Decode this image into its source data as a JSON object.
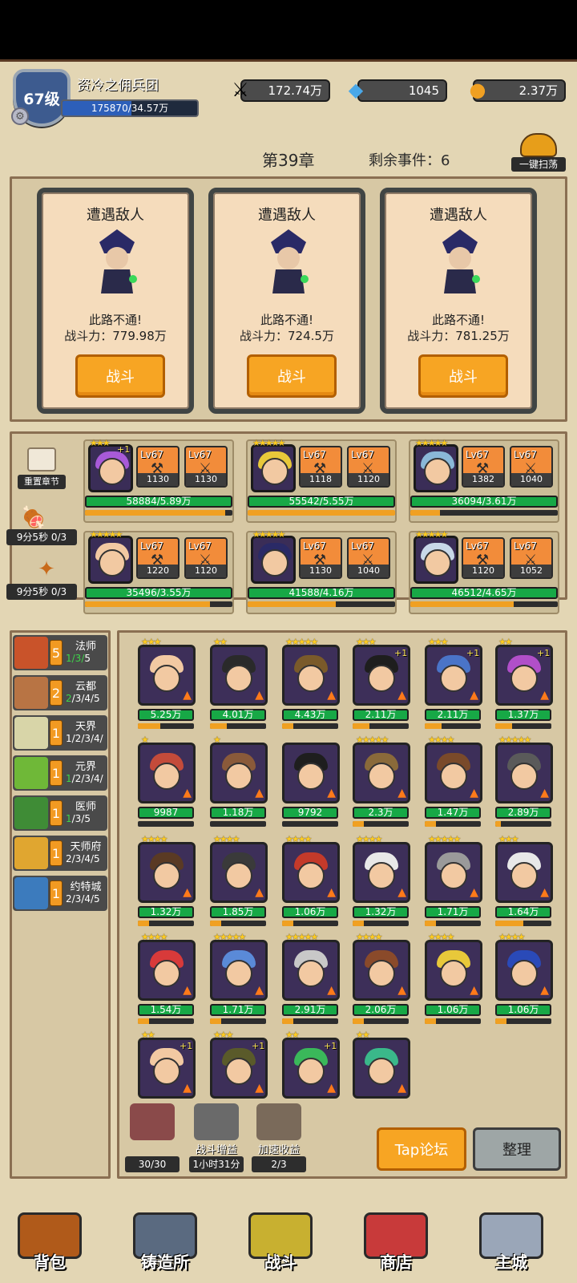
{
  "header": {
    "level": "67级",
    "guild_name": "资冷之佣兵团",
    "exp_text": "175870/34.57万",
    "exp_ratio": 0.51,
    "power": "172.74万",
    "gems": "1045",
    "gold": "2.37万"
  },
  "chapter": {
    "title": "第39章",
    "remaining": "剩余事件：6",
    "sweep_label": "一键扫荡"
  },
  "events": [
    {
      "title": "遭遇敌人",
      "msg": "此路不通!",
      "power": "战斗力：779.98万",
      "button": "战斗"
    },
    {
      "title": "遭遇敌人",
      "msg": "此路不通!",
      "power": "战斗力：724.5万",
      "button": "战斗"
    },
    {
      "title": "遭遇敌人",
      "msg": "此路不通!",
      "power": "战斗力：781.25万",
      "button": "战斗"
    }
  ],
  "side_actions": {
    "reset": "重置章节",
    "timer1": "9分5秒 0/3",
    "timer2": "9分5秒 0/3"
  },
  "team": [
    {
      "stars": "★★★",
      "plus": "+1",
      "eq1_lv": "Lv67",
      "eq1": "1130",
      "eq2_lv": "Lv67",
      "eq2": "1130",
      "hp": "58884/5.89万",
      "fill": 0.95
    },
    {
      "stars": "★★★★★",
      "plus": "",
      "eq1_lv": "Lv67",
      "eq1": "1118",
      "eq2_lv": "Lv67",
      "eq2": "1120",
      "hp": "55542/5.55万",
      "fill": 1.0
    },
    {
      "stars": "★★★★★",
      "plus": "",
      "eq1_lv": "Lv67",
      "eq1": "1382",
      "eq2_lv": "Lv67",
      "eq2": "1040",
      "hp": "36094/3.61万",
      "fill": 0.2
    },
    {
      "stars": "★★★★★",
      "plus": "",
      "eq1_lv": "Lv67",
      "eq1": "1220",
      "eq2_lv": "Lv67",
      "eq2": "1120",
      "hp": "35496/3.55万",
      "fill": 0.85
    },
    {
      "stars": "★★★★★",
      "plus": "",
      "eq1_lv": "Lv67",
      "eq1": "1130",
      "eq2_lv": "Lv67",
      "eq2": "1040",
      "hp": "41588/4.16万",
      "fill": 0.6
    },
    {
      "stars": "★★★★★",
      "plus": "",
      "eq1_lv": "Lv67",
      "eq1": "1120",
      "eq2_lv": "Lv67",
      "eq2": "1052",
      "hp": "46512/4.65万",
      "fill": 0.7
    }
  ],
  "factions": [
    {
      "name": "法师",
      "count": "5",
      "prog_green": "1/3/",
      "prog_rest": "5",
      "color": "#c9532a"
    },
    {
      "name": "云都",
      "count": "2",
      "prog_green": "2",
      "prog_rest": "/3/4/5",
      "color": "#b87444"
    },
    {
      "name": "天界",
      "count": "1",
      "prog_green": "",
      "prog_rest": "1/2/3/4/",
      "color": "#d8d5a8"
    },
    {
      "name": "元界",
      "count": "1",
      "prog_green": "1",
      "prog_rest": "/2/3/4/",
      "color": "#6fb838"
    },
    {
      "name": "医师",
      "count": "1",
      "prog_green": "1",
      "prog_rest": "/3/5",
      "color": "#3f8c36"
    },
    {
      "name": "天师府",
      "count": "1",
      "prog_green": "",
      "prog_rest": "2/3/4/5",
      "color": "#e0a630"
    },
    {
      "name": "约特城",
      "count": "1",
      "prog_green": "",
      "prog_rest": "2/3/4/5",
      "color": "#3c7bbd"
    }
  ],
  "roster": [
    {
      "stars": "★★★",
      "plus": "",
      "power": "5.25万",
      "hair": "#f2c9a2",
      "fill": 0.4
    },
    {
      "stars": "★★",
      "plus": "",
      "power": "4.01万",
      "hair": "#2a2a2a",
      "fill": 0.3
    },
    {
      "stars": "★★★★★",
      "plus": "",
      "power": "4.43万",
      "hair": "#7a5a2a",
      "fill": 0.2
    },
    {
      "stars": "★★★",
      "plus": "+1",
      "power": "2.11万",
      "hair": "#1e1e1e",
      "fill": 0.3
    },
    {
      "stars": "★★★",
      "plus": "+1",
      "power": "2.11万",
      "hair": "#4a74c8",
      "fill": 0.3
    },
    {
      "stars": "★★",
      "plus": "+1",
      "power": "1.37万",
      "hair": "#b14fc9",
      "fill": 0.3
    },
    {
      "stars": "★",
      "plus": "",
      "power": "9987",
      "hair": "#c44b3a",
      "fill": 0.0
    },
    {
      "stars": "★",
      "plus": "",
      "power": "1.18万",
      "hair": "#8a5a3a",
      "fill": 0.0
    },
    {
      "stars": "",
      "plus": "",
      "power": "9792",
      "hair": "#1e1e1e",
      "fill": 0.0
    },
    {
      "stars": "★★★★★",
      "plus": "",
      "power": "2.3万",
      "hair": "#8a6a3a",
      "fill": 0.2
    },
    {
      "stars": "★★★★",
      "plus": "",
      "power": "1.47万",
      "hair": "#7a4a2a",
      "fill": 0.2
    },
    {
      "stars": "★★★★★",
      "plus": "",
      "power": "2.89万",
      "hair": "#5a5a5a",
      "fill": 0.1
    },
    {
      "stars": "★★★★",
      "plus": "",
      "power": "1.32万",
      "hair": "#5a3a24",
      "fill": 0.2
    },
    {
      "stars": "★★★★",
      "plus": "",
      "power": "1.85万",
      "hair": "#3a3a3a",
      "fill": 0.2
    },
    {
      "stars": "★★★★",
      "plus": "",
      "power": "1.06万",
      "hair": "#c43a2a",
      "fill": 0.2
    },
    {
      "stars": "★★★★",
      "plus": "",
      "power": "1.32万",
      "hair": "#e8e8e8",
      "fill": 0.2
    },
    {
      "stars": "★★★★★",
      "plus": "",
      "power": "1.71万",
      "hair": "#9a9a9a",
      "fill": 0.2
    },
    {
      "stars": "★★★",
      "plus": "",
      "power": "1.64万",
      "hair": "#e8e8e8",
      "fill": 0.5
    },
    {
      "stars": "★★★★",
      "plus": "",
      "power": "1.54万",
      "hair": "#d83a3a",
      "fill": 0.2
    },
    {
      "stars": "★★★★★",
      "plus": "",
      "power": "1.71万",
      "hair": "#5a8ad8",
      "fill": 0.2
    },
    {
      "stars": "★★★★★",
      "plus": "",
      "power": "2.91万",
      "hair": "#c8c8c8",
      "fill": 0.2
    },
    {
      "stars": "★★★★",
      "plus": "",
      "power": "2.06万",
      "hair": "#8a4a2a",
      "fill": 0.2
    },
    {
      "stars": "★★★★",
      "plus": "",
      "power": "1.06万",
      "hair": "#e8c83a",
      "fill": 0.2
    },
    {
      "stars": "★★★★",
      "plus": "",
      "power": "1.06万",
      "hair": "#2a4ab8",
      "fill": 0.2
    },
    {
      "stars": "★★",
      "plus": "+1",
      "power": "",
      "hair": "#f2c9a2",
      "fill": 0.0
    },
    {
      "stars": "★★★",
      "plus": "+1",
      "power": "",
      "hair": "#5a5a2a",
      "fill": 0.0
    },
    {
      "stars": "★★",
      "plus": "+1",
      "power": "",
      "hair": "#3ab85a",
      "fill": 0.0
    },
    {
      "stars": "★★",
      "plus": "",
      "power": "",
      "hair": "#3ab88a",
      "fill": 0.0
    }
  ],
  "tools": [
    {
      "label": "",
      "sub": "30/30"
    },
    {
      "label": "战斗增益",
      "sub": "1小时31分"
    },
    {
      "label": "加速收益",
      "sub": "2/3"
    }
  ],
  "buttons": {
    "tap": "Tap论坛",
    "sort": "整理"
  },
  "nav": [
    {
      "label": "背包",
      "color": "#b05a1a"
    },
    {
      "label": "铸造所",
      "color": "#5a6a80"
    },
    {
      "label": "战斗",
      "color": "#c8b030"
    },
    {
      "label": "商店",
      "color": "#c83a3a"
    },
    {
      "label": "主城",
      "color": "#9aa6b8"
    }
  ]
}
